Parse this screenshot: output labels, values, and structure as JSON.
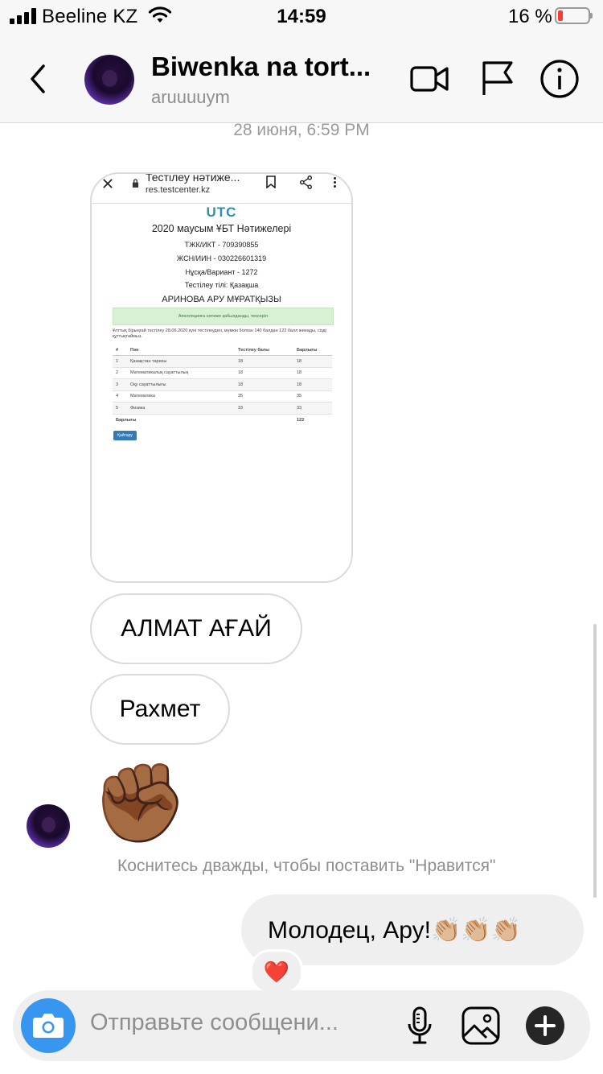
{
  "status_bar": {
    "carrier": "Beeline KZ",
    "time": "14:59",
    "battery_percent": "16 %",
    "battery_level": 0.16
  },
  "header": {
    "title": "Biwenka na tort...",
    "username": "aruuuuym"
  },
  "chat": {
    "date_label": "28 июня, 6:59 PM",
    "screenshot": {
      "page_title": "Тестілеу нәтиже...",
      "url": "res.testcenter.kz",
      "logo": "UTC",
      "heading": "2020 маусым ҰБТ Нәтижелері",
      "info": [
        "ТЖК/ИКТ - 709390855",
        "ЖСН/ИИН - 030226601319",
        "Нұсқа/Вариант - 1272",
        "Тестілеу тілі: Қазақша"
      ],
      "name": "АРИНОВА АРУ МҰРАТҚЫЗЫ",
      "notice": "Апелляцияға нәтиже қабылданды, тексеріл",
      "paragraph": "Ұлттық бірыңғай тестілеу 28.06.2020 күні тестілеуден, мүмкін болған 140 балдан 122 балл жинады, сізді құттықтаймыз.",
      "table": {
        "headers": [
          "#",
          "Пән",
          "Тестілеу балы",
          "Барлығы"
        ],
        "rows": [
          [
            "1",
            "Қазақстан тарихы",
            "18",
            "18"
          ],
          [
            "2",
            "Математикалық сауаттылық",
            "18",
            "18"
          ],
          [
            "3",
            "Оқу сауаттылығы",
            "18",
            "18"
          ],
          [
            "4",
            "Математика",
            "35",
            "35"
          ],
          [
            "5",
            "Физика",
            "33",
            "33"
          ]
        ],
        "total_label": "Барлығы",
        "total": "122"
      },
      "print_button": "Қайтару"
    },
    "messages_in": [
      "АЛМАТ АҒАЙ",
      "Рахмет"
    ],
    "emoji_message": "✊🏾",
    "double_tap_hint": "Коснитесь дважды, чтобы поставить \"Нравится\"",
    "message_out": "Молодец, Ару!👏🏼👏🏼👏🏼",
    "reaction": "❤️"
  },
  "composer": {
    "placeholder": "Отправьте сообщени..."
  },
  "colors": {
    "accent": "#3797f0",
    "bubble_out": "#efefef",
    "bubble_border": "#dbdbdb",
    "muted_text": "#8e8e8e",
    "battery_low": "#ff3b30"
  }
}
